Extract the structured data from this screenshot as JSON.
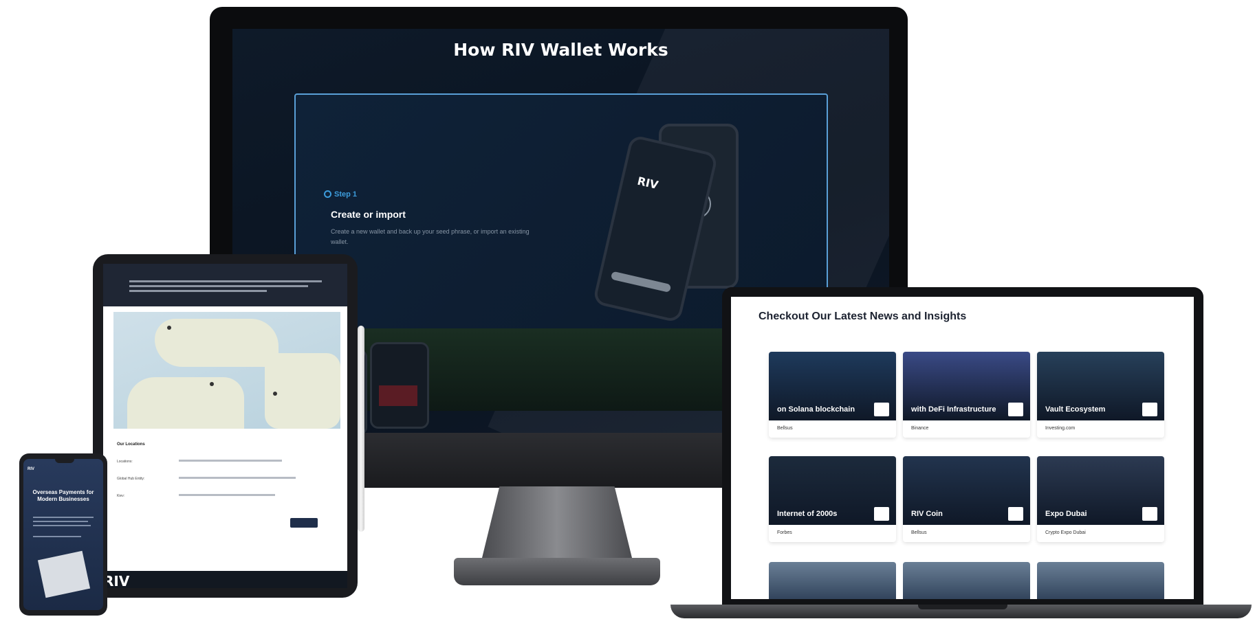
{
  "monitor": {
    "title": "How RIV Wallet Works",
    "step_label": "Step 1",
    "step_title": "Create or import",
    "step_desc": "Create a new wallet and back up your seed phrase, or import an existing wallet."
  },
  "tablet": {
    "section_title": "Our Locations",
    "rows": [
      "Locations:",
      "Global Hub Entity:",
      "Kiev:"
    ],
    "footer_logo": "RIV"
  },
  "phone": {
    "logo": "RIV",
    "title": "Overseas Payments for Modern Businesses"
  },
  "laptop": {
    "news_title": "Checkout Our Latest News and Insights",
    "cards": [
      {
        "caption": "on Solana blockchain",
        "source": "Bellsus",
        "color": "#1e3a5c"
      },
      {
        "caption": "with DeFi Infrastructure",
        "source": "Binance",
        "color": "#3a4a86"
      },
      {
        "caption": "Vault Ecosystem",
        "source": "Investing.com",
        "color": "#27405a"
      },
      {
        "caption": "Internet of 2000s",
        "source": "Forbes",
        "color": "#1c2a3c"
      },
      {
        "caption": "RIV Coin",
        "source": "Bellsus",
        "color": "#22344e"
      },
      {
        "caption": "Expo Dubai",
        "source": "Crypto Expo Dubai",
        "color": "#2c3a52"
      }
    ]
  }
}
